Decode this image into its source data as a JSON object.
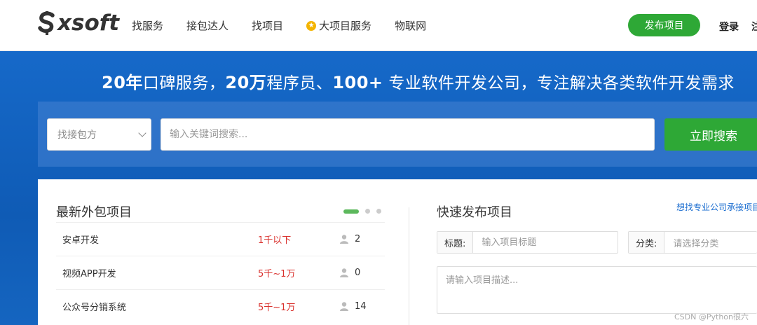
{
  "header": {
    "logo_text": "xsoft",
    "nav": [
      {
        "label": "找服务"
      },
      {
        "label": "接包达人"
      },
      {
        "label": "找项目"
      },
      {
        "label": "大项目服务"
      },
      {
        "label": "物联网"
      }
    ],
    "publish_label": "发布项目",
    "login_label": "登录",
    "register_label": "注册"
  },
  "banner": {
    "slogan_part1": "20年",
    "slogan_part2": "口碑服务，",
    "slogan_part3": "20万",
    "slogan_part4": "程序员、",
    "slogan_part5": "100+",
    "slogan_part6": " 专业软件开发公司，专注解决各类软件开发需求"
  },
  "search": {
    "select_value": "找接包方",
    "input_placeholder": "输入关键词搜索...",
    "button_label": "立即搜索"
  },
  "latest": {
    "title": "最新外包项目",
    "projects": [
      {
        "name": "安卓开发",
        "budget": "1千以下",
        "count": "2"
      },
      {
        "name": "视频APP开发",
        "budget": "5千~1万",
        "count": "0"
      },
      {
        "name": "公众号分销系统",
        "budget": "5千~1万",
        "count": "14"
      }
    ]
  },
  "quick": {
    "title": "快速发布项目",
    "pro_link": "想找专业公司承接项目?",
    "title_label": "标题:",
    "title_placeholder": "输入项目标题",
    "category_label": "分类:",
    "category_value": "请选择分类",
    "desc_placeholder": "请输入项目描述..."
  },
  "watermark": "CSDN @Python很六"
}
